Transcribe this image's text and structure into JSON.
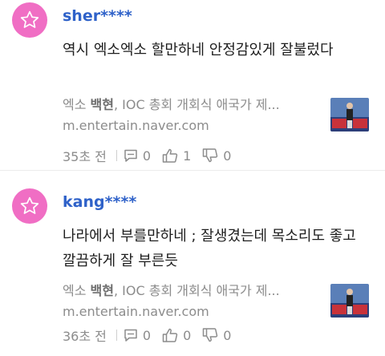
{
  "comments": [
    {
      "username": "sher****",
      "text": "역시 엑소엑소 할만하네 안정감있게 잘불렀다",
      "link": {
        "title_prefix": "엑소 ",
        "title_bold": "백현",
        "title_suffix": ", IOC 총회 개회식 애국가 제...",
        "url": "m.entertain.naver.com"
      },
      "time": "35초 전",
      "reply_count": "0",
      "like_count": "1",
      "dislike_count": "0"
    },
    {
      "username": "kang****",
      "text": "나라에서 부를만하네 ; 잘생겼는데 목소리도 좋고 깔끔하게 잘 부른듯",
      "link": {
        "title_prefix": "엑소 ",
        "title_bold": "백현",
        "title_suffix": ", IOC 총회 개회식 애국가 제...",
        "url": "m.entertain.naver.com"
      },
      "time": "36초 전",
      "reply_count": "0",
      "like_count": "0",
      "dislike_count": "0"
    }
  ],
  "colors": {
    "avatar": "#f06ec4",
    "username": "#2f62c9",
    "muted": "#8c8c8c"
  },
  "icons": [
    "star-icon",
    "reply-icon",
    "thumbs-up-icon",
    "thumbs-down-icon"
  ]
}
